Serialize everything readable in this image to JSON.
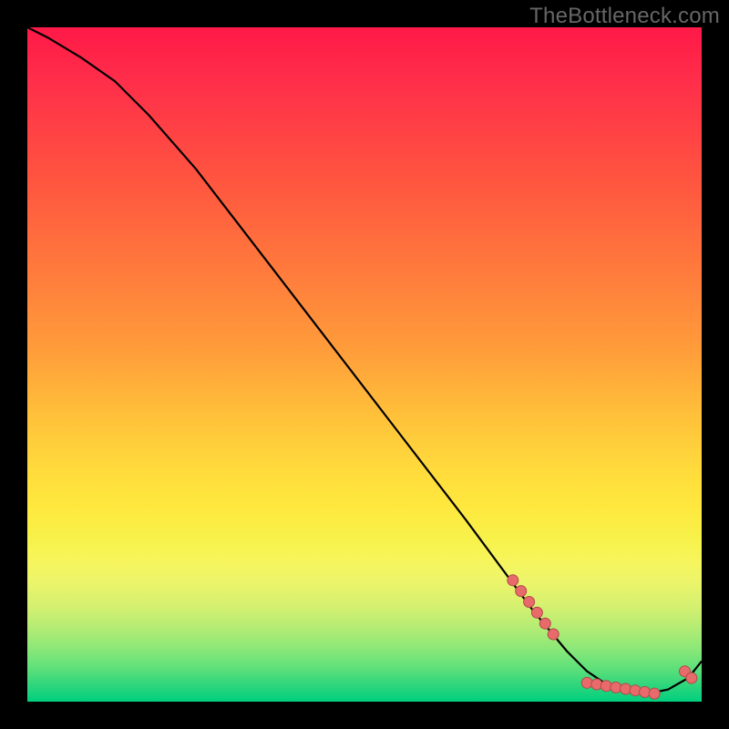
{
  "watermark": "TheBottleneck.com",
  "chart_data": {
    "type": "line",
    "x": [
      0.0,
      0.03,
      0.08,
      0.13,
      0.18,
      0.25,
      0.35,
      0.45,
      0.55,
      0.65,
      0.75,
      0.8,
      0.83,
      0.86,
      0.89,
      0.92,
      0.95,
      0.98,
      1.0
    ],
    "y": [
      1.0,
      0.985,
      0.955,
      0.92,
      0.87,
      0.79,
      0.66,
      0.53,
      0.4,
      0.27,
      0.135,
      0.075,
      0.045,
      0.025,
      0.015,
      0.012,
      0.018,
      0.035,
      0.06
    ],
    "marker_clusters": [
      {
        "x_range": [
          0.72,
          0.78
        ],
        "y_range": [
          0.18,
          0.1
        ],
        "count": 6
      },
      {
        "x_range": [
          0.83,
          0.93
        ],
        "y_range": [
          0.028,
          0.012
        ],
        "count": 8
      },
      {
        "x_range": [
          0.975,
          0.985
        ],
        "y_range": [
          0.045,
          0.035
        ],
        "count": 2
      }
    ],
    "title": "",
    "xlabel": "",
    "ylabel": "",
    "xlim": [
      0,
      1
    ],
    "ylim": [
      0,
      1
    ],
    "line_color": "#000000",
    "marker_color": "#e86a6a"
  }
}
